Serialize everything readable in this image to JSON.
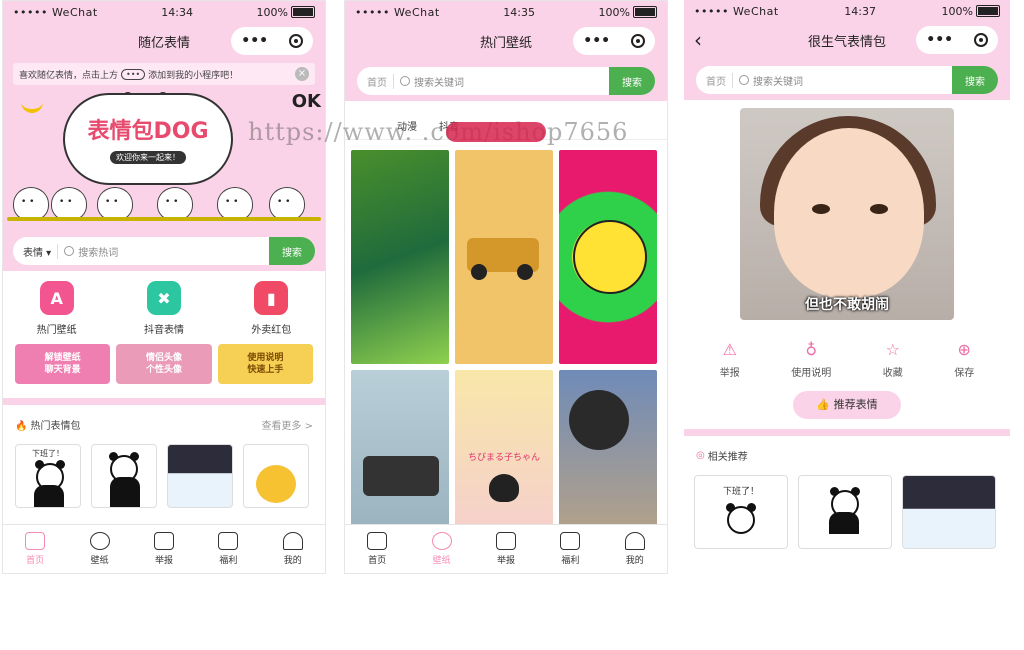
{
  "status": {
    "carrier": "••••• WeChat",
    "battery": "100%",
    "times": [
      "14:34",
      "14:35",
      "14:37"
    ]
  },
  "capsule": {
    "menu": "•••"
  },
  "p1": {
    "title": "随亿表情",
    "notice": {
      "before": "喜欢随亿表情，点击上方",
      "pill": "•••",
      "after": "添加到我的小程序吧！"
    },
    "banner": {
      "title": "表情包DOG",
      "subtitle": "欢迎你来一起来！",
      "ok": "OK"
    },
    "search": {
      "category": "表情",
      "placeholder": "搜索热词",
      "button": "搜索"
    },
    "quick": [
      {
        "label": "热门壁纸",
        "color": "#f2558f",
        "glyph": "A"
      },
      {
        "label": "抖音表情",
        "color": "#2cc7a0",
        "glyph": "✖"
      },
      {
        "label": "外卖红包",
        "color": "#f04a66",
        "glyph": "▮"
      }
    ],
    "promos": [
      {
        "line1": "解锁壁纸",
        "line2": "聊天背景",
        "color": "#f07fb1"
      },
      {
        "line1": "情侣头像",
        "line2": "个性头像",
        "color": "#e99bb8"
      },
      {
        "line1": "使用说明",
        "line2": "快速上手",
        "color": "#f6cf55"
      }
    ],
    "section": {
      "title": "热门表情包",
      "more": "查看更多 >"
    },
    "thumbs": [
      "下班了！",
      "",
      "",
      ""
    ]
  },
  "p2": {
    "title": "热门壁纸",
    "search": {
      "home": "首页",
      "placeholder": "搜索关键词",
      "button": "搜索"
    },
    "categories": [
      "动漫",
      "抖音"
    ],
    "cells": [
      {
        "bg": "linear-gradient(160deg,#4a8f2c,#1f6b3c 50%,#8fd14f)"
      },
      {
        "bg": "#f2c46a"
      },
      {
        "bg": "radial-gradient(circle at 50% 50%,#ffe233 30%,#2fd04a 31%,#2fd04a 55%,#e81a6e 56%)"
      },
      {
        "bg": "linear-gradient(#b9cfd8,#8fa9b6)"
      },
      {
        "bg": "linear-gradient(#f8e7a8,#f5c8d8)"
      },
      {
        "bg": "linear-gradient(#6f8bb8,#c9a97a)"
      }
    ],
    "cell_text": "ちびまる子ちゃん"
  },
  "p3": {
    "title": "很生气表情包",
    "search": {
      "home": "首页",
      "placeholder": "搜索关键词",
      "button": "搜索"
    },
    "caption": "但也不敢胡闹",
    "actions": [
      {
        "label": "举报",
        "icon": "⚠"
      },
      {
        "label": "使用说明",
        "icon": "♁"
      },
      {
        "label": "收藏",
        "icon": "☆"
      },
      {
        "label": "保存",
        "icon": "⊕"
      }
    ],
    "recommend": "推荐表情",
    "related_title": "相关推荐",
    "related": [
      "下班了！",
      "",
      ""
    ]
  },
  "tabs": [
    "首页",
    "壁纸",
    "举报",
    "福利",
    "我的"
  ],
  "watermark": "https://www.          .com/ishop7656",
  "colors": {
    "pink": "#fbd3e8",
    "green": "#4caf50",
    "active": "#f48bb4"
  }
}
